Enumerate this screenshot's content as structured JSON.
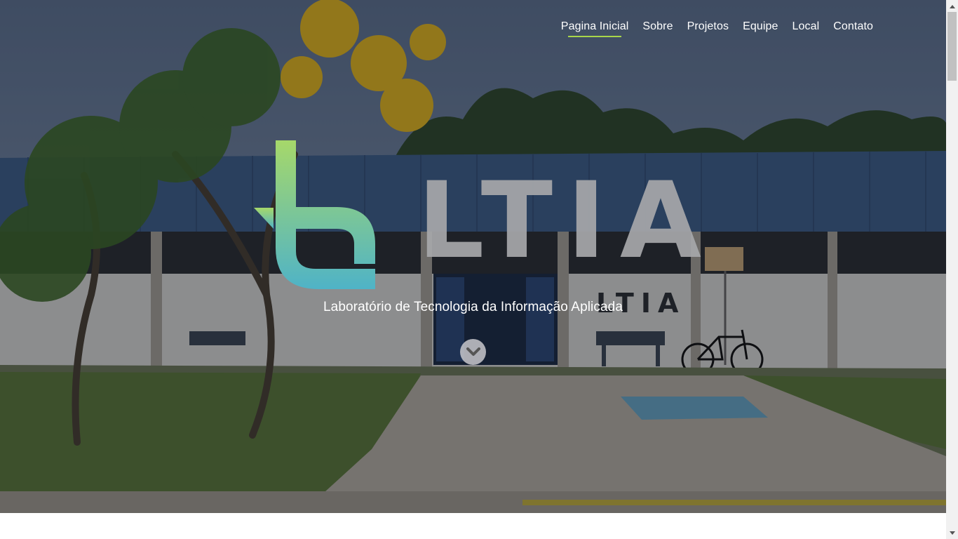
{
  "nav": {
    "items": [
      {
        "label": "Pagina Inicial",
        "active": true
      },
      {
        "label": "Sobre"
      },
      {
        "label": "Projetos"
      },
      {
        "label": "Equipe"
      },
      {
        "label": "Local"
      },
      {
        "label": "Contato"
      }
    ]
  },
  "hero": {
    "logo_text": "LTIA",
    "building_sign_text": "LTIA",
    "subtitle": "Laboratório de Tecnologia da Informação Aplicada",
    "scroll_icon": "chevron-down-icon"
  },
  "colors": {
    "accent_green": "#a8d64a",
    "logo_gradient_top": "#a6d86a",
    "logo_gradient_bottom": "#4fb3c7",
    "logo_letters": "#a7a8ab"
  }
}
